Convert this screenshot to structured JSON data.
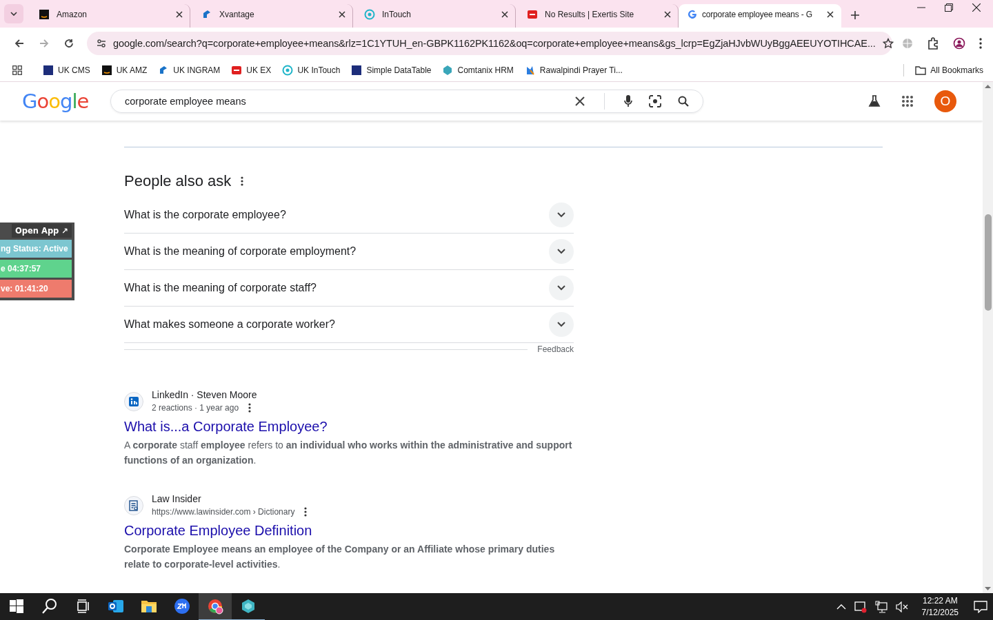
{
  "browser": {
    "tabs": [
      {
        "title": "Amazon",
        "selected": false
      },
      {
        "title": "Xvantage",
        "selected": false
      },
      {
        "title": "InTouch",
        "selected": false
      },
      {
        "title": "No Results | Exertis Site",
        "selected": false
      },
      {
        "title": "corporate employee means - G",
        "selected": true
      }
    ],
    "url": "google.com/search?q=corporate+employee+means&rlz=1C1YTUH_en-GBPK1162PK1162&oq=corporate+employee+means&gs_lcrp=EgZjaHJvbWUyBggAEEUYOTIHCAE...",
    "bookmarks": [
      {
        "label": "UK CMS"
      },
      {
        "label": "UK AMZ"
      },
      {
        "label": "UK INGRAM"
      },
      {
        "label": "UK EX"
      },
      {
        "label": "UK InTouch"
      },
      {
        "label": "Simple DataTable"
      },
      {
        "label": "Comtanix HRM"
      },
      {
        "label": "Rawalpindi Prayer Ti..."
      }
    ],
    "all_bookmarks": "All Bookmarks"
  },
  "google": {
    "logo": "Google",
    "query": "corporate employee means",
    "avatar": "O"
  },
  "people_also_ask": {
    "title": "People also ask",
    "questions": [
      {
        "text": "What is the corporate employee?",
        "expanded": false
      },
      {
        "text": "What is the meaning of corporate employment?",
        "expanded": false
      },
      {
        "text": "What is the meaning of corporate staff?",
        "expanded": false
      },
      {
        "text": "What makes someone a corporate worker?",
        "expanded": false
      }
    ],
    "feedback": "Feedback"
  },
  "results": [
    {
      "source": "LinkedIn · Steven Moore",
      "meta": "2 reactions · 1 year ago",
      "title": "What is...a Corporate Employee?",
      "snippet": "A **corporate** staff **employee** refers to **an individual who works within the administrative and support functions of an organization**."
    },
    {
      "source": "Law Insider",
      "meta": "https://www.lawinsider.com › Dictionary",
      "title": "Corporate Employee Definition",
      "snippet": "**Corporate Employee means an employee of the Company or an Affiliate whose primary duties relate to corporate-level activities**."
    }
  ],
  "widget": {
    "open_app": "Open App ↗",
    "rows": [
      {
        "text": "ng Status: Active",
        "color": "#7cc6d0"
      },
      {
        "text": "e 04:37:57",
        "color": "#5fd38d"
      },
      {
        "text": "ve: 01:41:20",
        "color": "#ee7b6d"
      }
    ]
  },
  "taskbar": {
    "apps": [
      {
        "kind": "start",
        "selected": false,
        "running": false
      },
      {
        "kind": "search",
        "selected": false,
        "running": false
      },
      {
        "kind": "taskview",
        "selected": false,
        "running": false
      },
      {
        "kind": "mail",
        "selected": false,
        "running": false
      },
      {
        "kind": "folder",
        "selected": false,
        "running": false
      },
      {
        "kind": "video",
        "selected": false,
        "running": false
      },
      {
        "kind": "browser",
        "selected": true,
        "running": true
      },
      {
        "kind": "gem",
        "selected": false,
        "running": true
      }
    ],
    "time": "12:22 AM",
    "date": "7/12/2025"
  }
}
